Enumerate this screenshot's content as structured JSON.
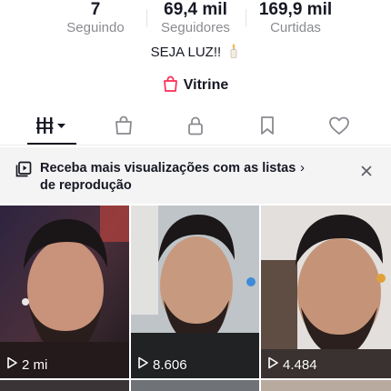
{
  "stats": [
    {
      "value": "7",
      "label": "Seguindo"
    },
    {
      "value": "69,4 mil",
      "label": "Seguidores"
    },
    {
      "value": "169,9 mil",
      "label": "Curtidas"
    }
  ],
  "bio": {
    "text": "SEJA LUZ!!",
    "emoji_icon": "candle-icon"
  },
  "storefront": {
    "label": "Vitrine",
    "icon": "shopping-bag-icon",
    "accent": "#fe2c55"
  },
  "tabs": [
    {
      "name": "videos",
      "icon": "grid-icon",
      "selected": true
    },
    {
      "name": "shop",
      "icon": "shopping-bag-icon"
    },
    {
      "name": "private",
      "icon": "lock-icon"
    },
    {
      "name": "saved",
      "icon": "bookmark-icon"
    },
    {
      "name": "liked",
      "icon": "heart-icon"
    }
  ],
  "banner": {
    "text": "Receba mais visualizações com as listas de reprodução",
    "chevron": "›",
    "icon": "playlist-icon",
    "close_icon": "close-icon"
  },
  "videos": [
    {
      "views": "2 mi"
    },
    {
      "views": "8.606"
    },
    {
      "views": "4.484"
    }
  ]
}
